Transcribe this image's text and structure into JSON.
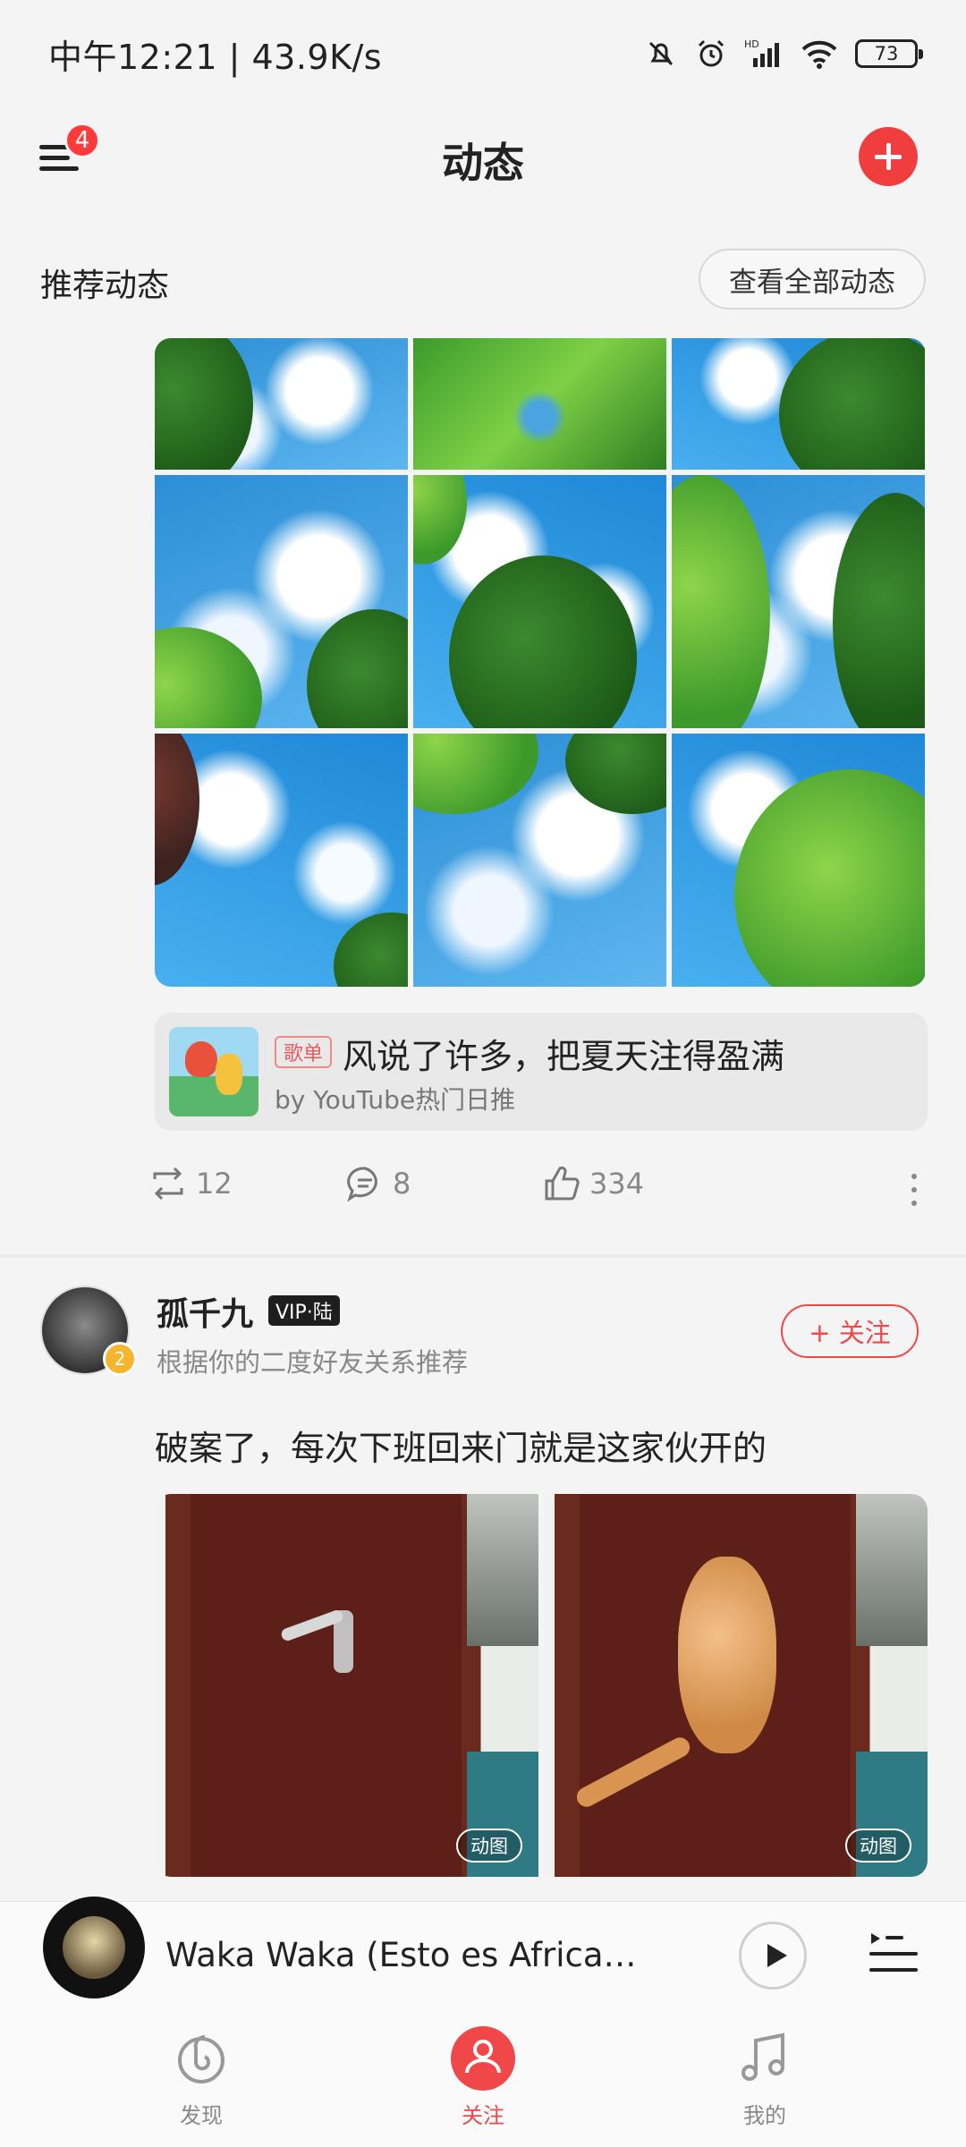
{
  "status_bar": {
    "time": "中午12:21 | 43.9K/s",
    "battery": "73"
  },
  "header": {
    "title": "动态",
    "menu_badge": "4"
  },
  "recommend": {
    "section_title": "推荐动态",
    "view_all_label": "查看全部动态"
  },
  "post1": {
    "playlist_tag": "歌单",
    "playlist_title": "风说了许多，把夏天注得盈满",
    "playlist_by": "by YouTube热门日推",
    "repost_count": "12",
    "comment_count": "8",
    "like_count": "334"
  },
  "post2": {
    "username": "孤千九",
    "vip_badge": "VIP·陆",
    "avatar_level": "2",
    "subtitle": "根据你的二度好友关系推荐",
    "follow_label": "+ 关注",
    "text": "破案了，每次下班回来门就是这家伙开的",
    "gif_badge_1": "动图",
    "gif_badge_2": "动图"
  },
  "player": {
    "song_title": "Waka Waka (Esto es Africa) (…"
  },
  "bottom_nav": [
    {
      "label": "发现",
      "icon": "discover-icon"
    },
    {
      "label": "关注",
      "icon": "follow-icon"
    },
    {
      "label": "我的",
      "icon": "music-note-icon"
    }
  ],
  "colors": {
    "accent": "#f04848",
    "background": "#f4f4f4"
  }
}
